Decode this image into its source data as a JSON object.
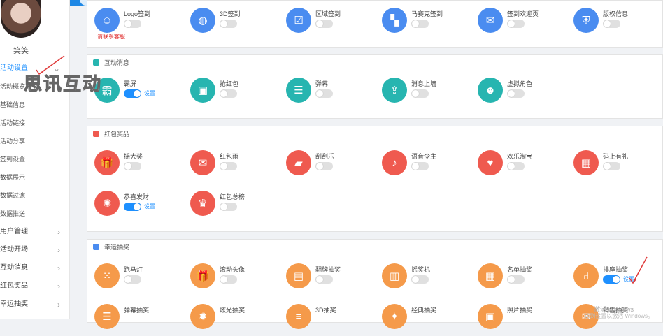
{
  "user": {
    "name": "笑笑"
  },
  "sidebar": {
    "items": [
      {
        "label": "活动设置",
        "active": true,
        "chevron": true
      },
      {
        "label": "活动概览",
        "sub": true
      },
      {
        "label": "基础信息",
        "sub": true
      },
      {
        "label": "活动链接",
        "sub": true
      },
      {
        "label": "活动分享",
        "sub": true
      },
      {
        "label": "签到设置",
        "sub": true
      },
      {
        "label": "数据展示",
        "sub": true
      },
      {
        "label": "数据过滤",
        "sub": true
      },
      {
        "label": "数据推送",
        "sub": true
      },
      {
        "label": "用户管理",
        "chevron": true
      },
      {
        "label": "活动开场",
        "chevron": true
      },
      {
        "label": "互动消息",
        "chevron": true
      },
      {
        "label": "红包奖品",
        "chevron": true
      },
      {
        "label": "幸运抽奖",
        "chevron": true
      }
    ]
  },
  "watermark": "思讯互动",
  "sections": {
    "signin": {
      "items": [
        {
          "label": "Logo签到",
          "on": false,
          "note": "请联系客服"
        },
        {
          "label": "3D签到",
          "on": false
        },
        {
          "label": "区域签到",
          "on": false
        },
        {
          "label": "马赛克签到",
          "on": false
        },
        {
          "label": "签到欢迎页",
          "on": false
        },
        {
          "label": "版权信息",
          "on": false
        }
      ]
    },
    "interact": {
      "title": "互动消息",
      "items": [
        {
          "label": "霸屏",
          "on": true,
          "setting": "设置"
        },
        {
          "label": "抢红包",
          "on": false
        },
        {
          "label": "弹幕",
          "on": false
        },
        {
          "label": "消息上墙",
          "on": false
        },
        {
          "label": "虚拟角色",
          "on": false
        }
      ]
    },
    "redpack": {
      "title": "红包奖品",
      "items": [
        {
          "label": "摇大奖",
          "on": false
        },
        {
          "label": "红包雨",
          "on": false
        },
        {
          "label": "刮刮乐",
          "on": false
        },
        {
          "label": "语音令主",
          "on": false
        },
        {
          "label": "欢乐淘宝",
          "on": false
        },
        {
          "label": "码上有礼",
          "on": false
        },
        {
          "label": "恭喜发财",
          "on": true,
          "setting": "设置"
        },
        {
          "label": "红包总榜",
          "on": false
        }
      ]
    },
    "lottery": {
      "title": "幸运抽奖",
      "items": [
        {
          "label": "跑马灯",
          "on": false
        },
        {
          "label": "滚动头像",
          "on": false
        },
        {
          "label": "翻牌抽奖",
          "on": false
        },
        {
          "label": "摇奖机",
          "on": false
        },
        {
          "label": "名单抽奖",
          "on": false
        },
        {
          "label": "排座抽奖",
          "on": true,
          "setting": "设置"
        },
        {
          "label": "弹幕抽奖"
        },
        {
          "label": "炫光抽奖"
        },
        {
          "label": "3D抽奖"
        },
        {
          "label": "经典抽奖"
        },
        {
          "label": "照片抽奖"
        },
        {
          "label": "销售抽奖"
        }
      ]
    }
  },
  "windows": {
    "line1": "激活 Windows",
    "line2": "转到设置以激活 Windows。"
  },
  "colors": {
    "primary": "#1e90ff",
    "blue": "#4a8cf0",
    "teal": "#27b5b0",
    "red": "#ef5a4f",
    "orange": "#f59a4a"
  }
}
